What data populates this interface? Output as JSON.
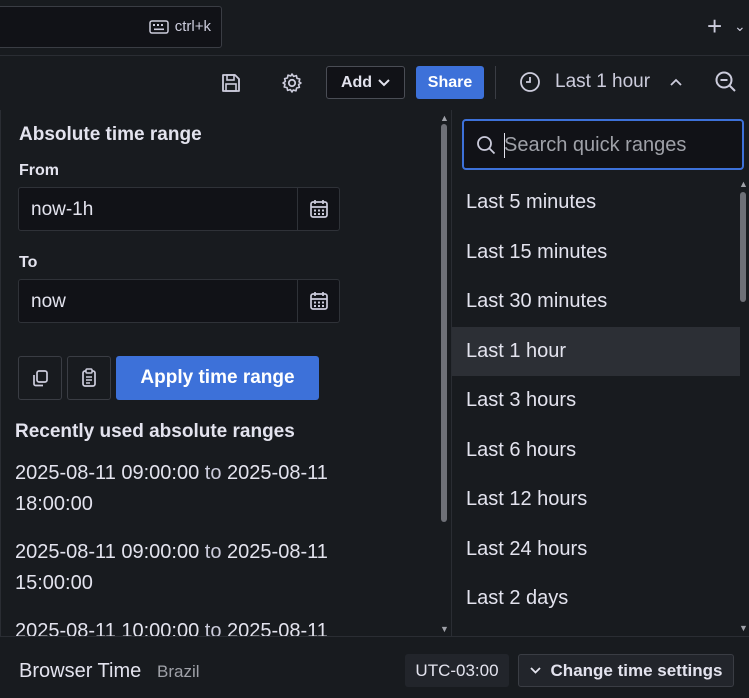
{
  "topbar": {
    "shortcut": "ctrl+k"
  },
  "toolbar": {
    "add_label": "Add",
    "share_label": "Share",
    "time_label": "Last 1 hour"
  },
  "absolute": {
    "title": "Absolute time range",
    "from_label": "From",
    "from_value": "now-1h",
    "to_label": "To",
    "to_value": "now",
    "apply_label": "Apply time range"
  },
  "recent": {
    "title": "Recently used absolute ranges",
    "items": [
      {
        "from": "2025-08-11 09:00:00",
        "sep": "to",
        "to_date": "2025-08-11",
        "to_time": "18:00:00"
      },
      {
        "from": "2025-08-11 09:00:00",
        "sep": "to",
        "to_date": "2025-08-11",
        "to_time": "15:00:00"
      },
      {
        "from": "2025-08-11 10:00:00",
        "sep": "to",
        "to_date": "2025-08-11",
        "to_time": ""
      }
    ]
  },
  "quick": {
    "search_placeholder": "Search quick ranges",
    "items": [
      "Last 5 minutes",
      "Last 15 minutes",
      "Last 30 minutes",
      "Last 1 hour",
      "Last 3 hours",
      "Last 6 hours",
      "Last 12 hours",
      "Last 24 hours",
      "Last 2 days"
    ],
    "active_index": 3
  },
  "footer": {
    "title": "Browser Time",
    "zone": "Brazil",
    "utc": "UTC-03:00",
    "change_label": "Change time settings"
  },
  "colors": {
    "accent": "#3d71d9",
    "background": "#181b1f"
  }
}
